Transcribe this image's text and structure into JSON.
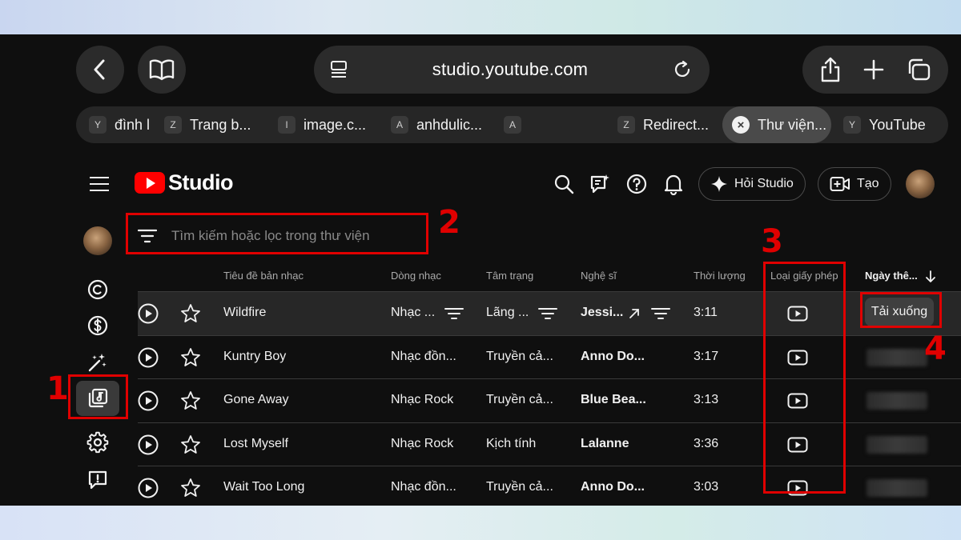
{
  "browser": {
    "url": "studio.youtube.com",
    "tabs": [
      {
        "favicon": "Y",
        "title": "đình l"
      },
      {
        "favicon": "Z",
        "title": "Trang b..."
      },
      {
        "favicon": "I",
        "title": "image.c..."
      },
      {
        "favicon": "A",
        "title": "anhdulic..."
      },
      {
        "favicon": "A",
        "title": ""
      },
      {
        "favicon": "Z",
        "title": "Redirect..."
      },
      {
        "favicon": "×",
        "title": "Thư viện...",
        "active": true
      },
      {
        "favicon": "Y",
        "title": "YouTube"
      }
    ]
  },
  "header": {
    "logo_text": "Studio",
    "ask_label": "Hỏi Studio",
    "create_label": "Tạo"
  },
  "search": {
    "placeholder": "Tìm kiếm hoặc lọc trong thư viện"
  },
  "table": {
    "columns": {
      "title": "Tiêu đề bản nhạc",
      "genre": "Dòng nhạc",
      "mood": "Tâm trạng",
      "artist": "Nghệ sĩ",
      "duration": "Thời lượng",
      "license": "Loại giấy phép",
      "date": "Ngày thê..."
    },
    "rows": [
      {
        "title": "Wildfire",
        "genre": "Nhạc ...",
        "mood": "Lãng ...",
        "artist": "Jessi...",
        "duration": "3:11",
        "download": "Tải xuống"
      },
      {
        "title": "Kuntry Boy",
        "genre": "Nhạc đồn...",
        "mood": "Truyền cả...",
        "artist": "Anno Do...",
        "duration": "3:17"
      },
      {
        "title": "Gone Away",
        "genre": "Nhạc Rock",
        "mood": "Truyền cả...",
        "artist": "Blue Bea...",
        "duration": "3:13"
      },
      {
        "title": "Lost Myself",
        "genre": "Nhạc Rock",
        "mood": "Kịch tính",
        "artist": "Lalanne",
        "duration": "3:36"
      },
      {
        "title": "Wait Too Long",
        "genre": "Nhạc đồn...",
        "mood": "Truyền cả...",
        "artist": "Anno Do...",
        "duration": "3:03"
      }
    ]
  },
  "annotations": [
    "1",
    "2",
    "3",
    "4"
  ],
  "colors": {
    "annotation_red": "#e00000",
    "youtube_red": "#ff0000",
    "background": "#0f0f0f"
  }
}
